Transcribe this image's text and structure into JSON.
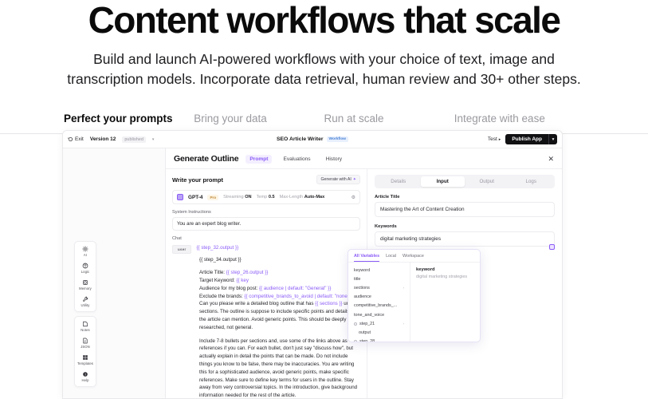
{
  "hero": {
    "title": "Content workflows that scale",
    "subtitle": "Build and launch AI-powered workflows with your choice of text, image and transcription models. Incorporate data retrieval, human review and 30+ other steps."
  },
  "tabs": [
    {
      "label": "Perfect your prompts",
      "active": true
    },
    {
      "label": "Bring your data",
      "active": false
    },
    {
      "label": "Run at scale",
      "active": false
    },
    {
      "label": "Integrate with ease",
      "active": false
    }
  ],
  "toolbar": {
    "exit_label": "Exit",
    "version_label": "Version 12",
    "status_badge": "published",
    "caret": "▾",
    "workflow_title": "SEO Article Writer",
    "workflow_badge": "Workflow",
    "test_label": "Test",
    "test_caret": "▸",
    "publish_label": "Publish App",
    "publish_dropdown_icon": "▾"
  },
  "rail": {
    "groups": [
      {
        "items": [
          {
            "label": "AI",
            "icon": "ai-sparkle-icon"
          },
          {
            "label": "Logic",
            "icon": "logic-branch-icon"
          },
          {
            "label": "Memory",
            "icon": "memory-cube-icon"
          },
          {
            "label": "Utility",
            "icon": "utility-wrench-icon"
          }
        ]
      },
      {
        "items": [
          {
            "label": "Notes",
            "icon": "notes-icon"
          },
          {
            "label": "JSON",
            "icon": "json-file-icon"
          },
          {
            "label": "Templates",
            "icon": "templates-grid-icon"
          },
          {
            "label": "Help",
            "icon": "help-circle-icon"
          }
        ]
      }
    ]
  },
  "modal": {
    "title": "Generate Outline",
    "tabs": [
      {
        "label": "Prompt",
        "active": true
      },
      {
        "label": "Evaluations",
        "active": false
      },
      {
        "label": "History",
        "active": false
      }
    ],
    "close_icon": "✕"
  },
  "prompt": {
    "heading": "Write your prompt",
    "generate_with_ai": "Generate with AI",
    "generate_icon": "✦",
    "model": {
      "name": "GPT-4",
      "plan_badge": "Pro",
      "streaming_label": "Streaming",
      "streaming_value": "ON",
      "temp_label": "Temp",
      "temp_value": "0.5",
      "maxlen_label": "Max-Length",
      "maxlen_value": "Auto-Max",
      "settings_icon": "⚙"
    },
    "system_label": "System Instructions",
    "system_value": "You are an expert blog writer.",
    "chat_label": "Chat",
    "role_badge": "user",
    "chat_line_1": "{{ step_32.output }}",
    "chat_line_2": "{{ step_34.output }}",
    "body_lines": [
      "Article Title: {{ step_26.output }}",
      "Target Keyword: {{ key",
      "Audience for my blog post: {{ audience | default: \"General\" }}",
      "Exclude the brands: {{ competitive_brands_to_avoid | default: \"none\" }}",
      "Can you please write a detailed blog outline that has {{ sections }} unique sections. The outline is suppose to include specific points and details that the article can mention. Avoid generic points. This should be deeply researched, not general."
    ],
    "body_paragraph": "Include 7-8 bullets per sections and, use some of the links above as references if you can. For each bullet, don't just say \"discuss how\", but actually explain in detail the points that can be made. Do not include things you know to be false, there may be inaccuracies. You are writing this for a sophisticated audience, avoid generic points, make specific references. Make sure to define key terms for users in the outline. Stay away from very controversial topics. In the introduction, give background information needed for the rest of the article."
  },
  "variables_popover": {
    "tabs": [
      {
        "label": "All Variables",
        "active": true
      },
      {
        "label": "Local",
        "active": false
      },
      {
        "label": "Workspace",
        "active": false
      }
    ],
    "items": [
      {
        "label": "keyword",
        "has_dot": false,
        "has_chevron": false,
        "sub": false
      },
      {
        "label": "title",
        "has_dot": false,
        "has_chevron": false,
        "sub": false
      },
      {
        "label": "sections",
        "has_dot": false,
        "has_chevron": true,
        "sub": false
      },
      {
        "label": "audience",
        "has_dot": false,
        "has_chevron": false,
        "sub": false
      },
      {
        "label": "competitive_brands_...",
        "has_dot": false,
        "has_chevron": false,
        "sub": false
      },
      {
        "label": "tone_and_voice",
        "has_dot": false,
        "has_chevron": false,
        "sub": false
      },
      {
        "label": "step_21",
        "has_dot": true,
        "has_chevron": true,
        "sub": false
      },
      {
        "label": "output",
        "has_dot": false,
        "has_chevron": false,
        "sub": true
      },
      {
        "label": "step_28",
        "has_dot": true,
        "has_chevron": true,
        "sub": false
      }
    ],
    "detail_key": "keyword",
    "detail_value": "digital marketing strategies"
  },
  "right_panel": {
    "segments": [
      {
        "label": "Details",
        "active": false
      },
      {
        "label": "Input",
        "active": true
      },
      {
        "label": "Output",
        "active": false
      },
      {
        "label": "Logs",
        "active": false
      }
    ],
    "fields": [
      {
        "label": "Article Title",
        "value": "Mastering the Art of Content Creation"
      },
      {
        "label": "Keywords",
        "value": "digital marketing strategies"
      }
    ]
  },
  "colors": {
    "accent_purple": "#8b5cf6",
    "badge_blue": "#4d84d6",
    "pro_gold": "#c18b3a",
    "dark": "#111114"
  }
}
